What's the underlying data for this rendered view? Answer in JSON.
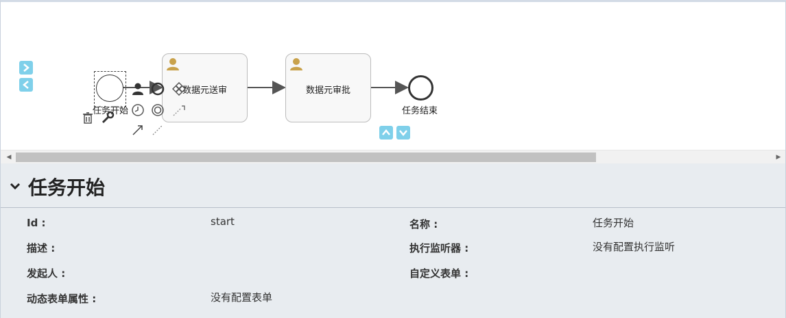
{
  "canvas": {
    "start_event": {
      "label": "任务开始"
    },
    "tasks": [
      {
        "label": "数据元送审"
      },
      {
        "label": "数据元审批"
      }
    ],
    "end_event": {
      "label": "任务结束"
    }
  },
  "properties": {
    "title": "任务开始",
    "fields": {
      "id_label": "Id :",
      "id_value": "start",
      "name_label": "名称 :",
      "name_value": "任务开始",
      "desc_label": "描述 :",
      "listener_label": "执行监听器 :",
      "listener_value": "没有配置执行监听",
      "initiator_label": "发起人 :",
      "form_label": "自定义表单 :",
      "dynform_label": "动态表单属性 :",
      "dynform_value": "没有配置表单"
    }
  },
  "colors": {
    "accent": "#7fd0ea",
    "panel_bg": "#e8ecf0",
    "user_icon": "#c9a24b"
  }
}
